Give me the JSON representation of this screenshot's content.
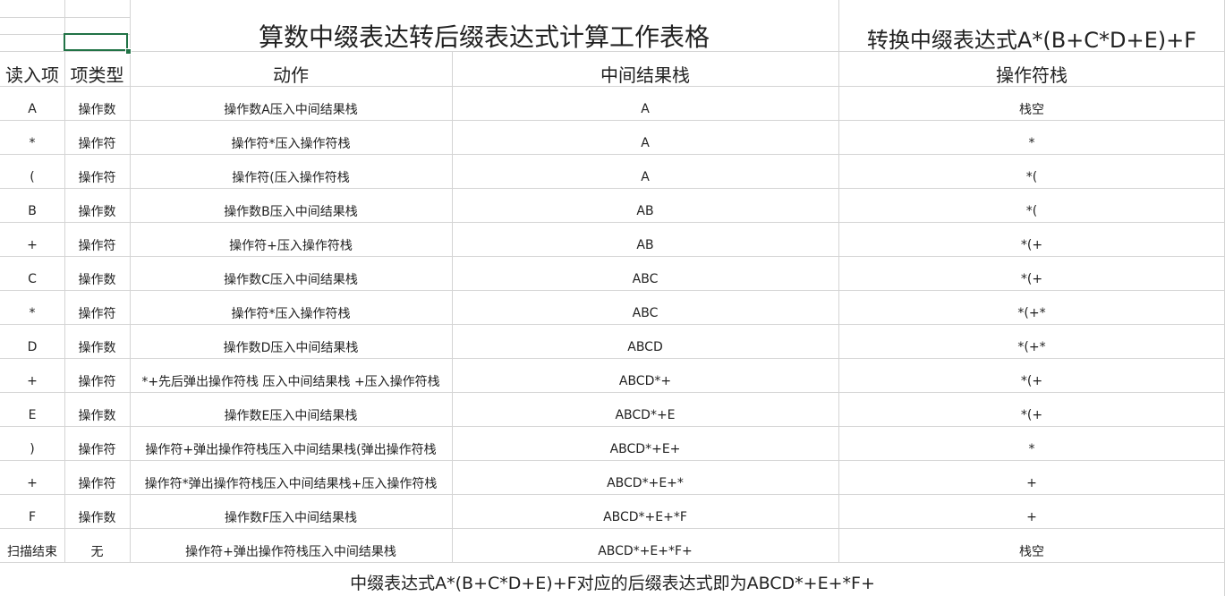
{
  "title": "算数中缀表达转后缀表达式计算工作表格",
  "subtitle": "转换中缀表达式A*(B+C*D+E)+F",
  "headers": [
    "读入项",
    "项类型",
    "动作",
    "中间结果栈",
    "操作符栈"
  ],
  "rows": [
    [
      "A",
      "操作数",
      "操作数A压入中间结果栈",
      "A",
      "栈空"
    ],
    [
      "*",
      "操作符",
      "操作符*压入操作符栈",
      "A",
      "*"
    ],
    [
      "(",
      "操作符",
      "操作符(压入操作符栈",
      "A",
      "*("
    ],
    [
      "B",
      "操作数",
      "操作数B压入中间结果栈",
      "AB",
      "*("
    ],
    [
      "+",
      "操作符",
      "操作符+压入操作符栈",
      "AB",
      "*(+"
    ],
    [
      "C",
      "操作数",
      "操作数C压入中间结果栈",
      "ABC",
      "*(+"
    ],
    [
      "*",
      "操作符",
      "操作符*压入操作符栈",
      "ABC",
      "*(+*"
    ],
    [
      "D",
      "操作数",
      "操作数D压入中间结果栈",
      "ABCD",
      "*(+*"
    ],
    [
      "+",
      "操作符",
      "*+先后弹出操作符栈 压入中间结果栈 +压入操作符栈",
      "ABCD*+",
      "*(+"
    ],
    [
      "E",
      "操作数",
      "操作数E压入中间结果栈",
      "ABCD*+E",
      "*(+"
    ],
    [
      ")",
      "操作符",
      "操作符+弹出操作符栈压入中间结果栈(弹出操作符栈",
      "ABCD*+E+",
      "*"
    ],
    [
      "+",
      "操作符",
      "操作符*弹出操作符栈压入中间结果栈+压入操作符栈",
      "ABCD*+E+*",
      "+"
    ],
    [
      "F",
      "操作数",
      "操作数F压入中间结果栈",
      "ABCD*+E+*F",
      "+"
    ],
    [
      "扫描结束",
      "无",
      "操作符+弹出操作符栈压入中间结果栈",
      "ABCD*+E+*F+",
      "栈空"
    ]
  ],
  "footer": "中缀表达式A*(B+C*D+E)+F对应的后缀表达式即为ABCD*+E+*F+",
  "colors": {
    "grid": "#d4d4d4",
    "selection": "#217346",
    "text": "#222222"
  }
}
